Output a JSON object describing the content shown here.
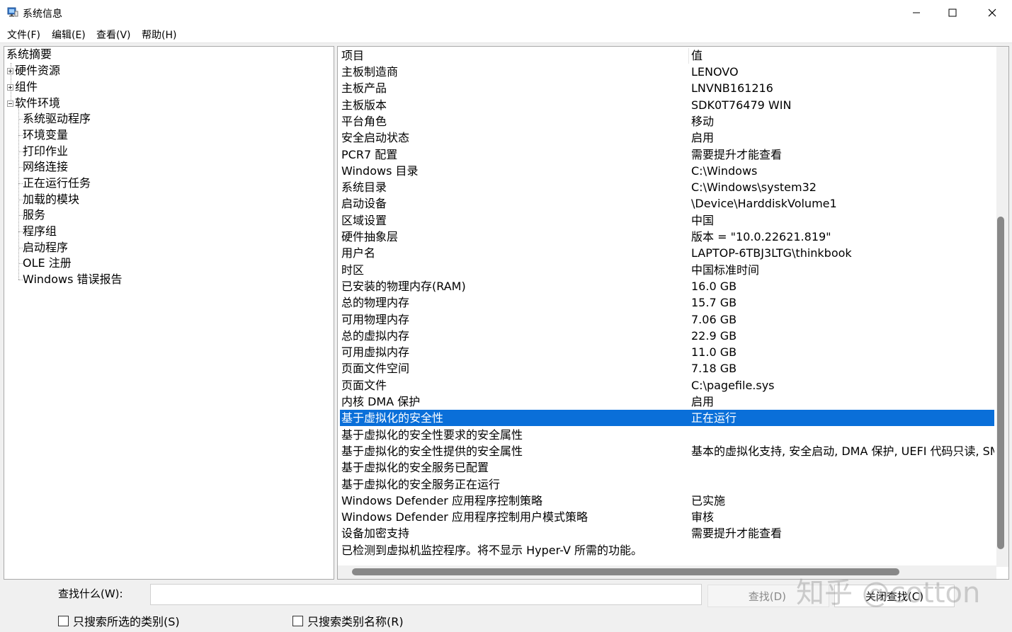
{
  "window": {
    "title": "系统信息"
  },
  "menu": [
    "文件(F)",
    "编辑(E)",
    "查看(V)",
    "帮助(H)"
  ],
  "tree": {
    "root": "系统摘要",
    "nodes": [
      {
        "label": "硬件资源",
        "expander": "plus"
      },
      {
        "label": "组件",
        "expander": "plus"
      },
      {
        "label": "软件环境",
        "expander": "minus"
      }
    ],
    "software_children": [
      "系统驱动程序",
      "环境变量",
      "打印作业",
      "网络连接",
      "正在运行任务",
      "加载的模块",
      "服务",
      "程序组",
      "启动程序",
      "OLE 注册",
      "Windows 错误报告"
    ]
  },
  "list": {
    "headers": [
      "项目",
      "值"
    ],
    "selected_index": 21,
    "rows": [
      [
        "主板制造商",
        "LENOVO"
      ],
      [
        "主板产品",
        "LNVNB161216"
      ],
      [
        "主板版本",
        "SDK0T76479 WIN"
      ],
      [
        "平台角色",
        "移动"
      ],
      [
        "安全启动状态",
        "启用"
      ],
      [
        "PCR7 配置",
        "需要提升才能查看"
      ],
      [
        "Windows 目录",
        "C:\\Windows"
      ],
      [
        "系统目录",
        "C:\\Windows\\system32"
      ],
      [
        "启动设备",
        "\\Device\\HarddiskVolume1"
      ],
      [
        "区域设置",
        "中国"
      ],
      [
        "硬件抽象层",
        "版本 = \"10.0.22621.819\""
      ],
      [
        "用户名",
        "LAPTOP-6TBJ3LTG\\thinkbook"
      ],
      [
        "时区",
        "中国标准时间"
      ],
      [
        "已安装的物理内存(RAM)",
        "16.0 GB"
      ],
      [
        "总的物理内存",
        "15.7 GB"
      ],
      [
        "可用物理内存",
        "7.06 GB"
      ],
      [
        "总的虚拟内存",
        "22.9 GB"
      ],
      [
        "可用虚拟内存",
        "11.0 GB"
      ],
      [
        "页面文件空间",
        "7.18 GB"
      ],
      [
        "页面文件",
        "C:\\pagefile.sys"
      ],
      [
        "内核 DMA 保护",
        "启用"
      ],
      [
        "基于虚拟化的安全性",
        "正在运行"
      ],
      [
        "基于虚拟化的安全性要求的安全属性",
        ""
      ],
      [
        "基于虚拟化的安全性提供的安全属性",
        "基本的虚拟化支持, 安全启动, DMA 保护, UEFI 代码只读, SM"
      ],
      [
        "基于虚拟化的安全服务已配置",
        ""
      ],
      [
        "基于虚拟化的安全服务正在运行",
        ""
      ],
      [
        "Windows Defender 应用程序控制策略",
        "已实施"
      ],
      [
        "Windows Defender 应用程序控制用户模式策略",
        "审核"
      ],
      [
        "设备加密支持",
        "需要提升才能查看"
      ],
      [
        "已检测到虚拟机监控程序。将不显示 Hyper-V 所需的功能。",
        ""
      ]
    ]
  },
  "find": {
    "label": "查找什么(W):",
    "value": "",
    "find_button": "查找(D)",
    "close_button": "关闭查找(C)",
    "check_selected_category": "只搜索所选的类别(S)",
    "check_category_names": "只搜索类别名称(R)"
  },
  "watermark": "知乎 @cotton",
  "colors": {
    "selection": "#0a6fd9"
  }
}
